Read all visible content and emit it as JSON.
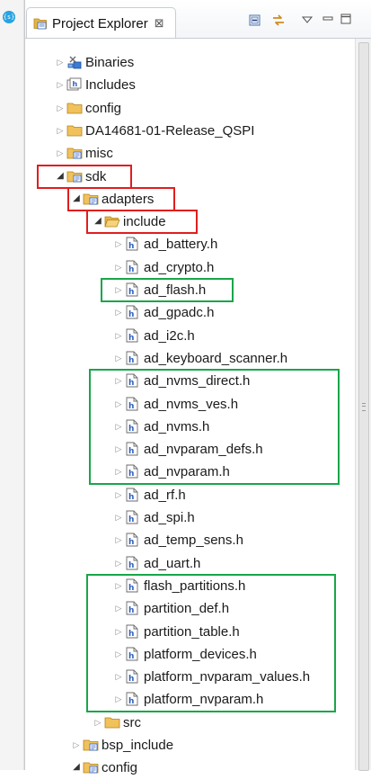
{
  "view": {
    "title": "Project Explorer",
    "close_glyph": "⊠",
    "side_icon": "{s}",
    "toolbar": [
      {
        "name": "collapse-all-icon"
      },
      {
        "name": "link-with-editor-icon"
      },
      {
        "name": "view-menu-icon"
      },
      {
        "name": "minimize-icon"
      },
      {
        "name": "maximize-icon"
      }
    ]
  },
  "colors": {
    "highlight_red": "#e01e1e",
    "highlight_green": "#19a64a",
    "folder": "#e9b443",
    "header_icon": "#2f5fbf"
  },
  "tree": [
    {
      "label": "Binaries",
      "kind": "binaries",
      "depth": 0,
      "state": "collapsed"
    },
    {
      "label": "Includes",
      "kind": "includes",
      "depth": 0,
      "state": "collapsed"
    },
    {
      "label": "config",
      "kind": "folder",
      "depth": 0,
      "state": "collapsed"
    },
    {
      "label": "DA14681-01-Release_QSPI",
      "kind": "folder",
      "depth": 0,
      "state": "collapsed"
    },
    {
      "label": "misc",
      "kind": "srcfolder",
      "depth": 0,
      "state": "collapsed"
    },
    {
      "label": "sdk",
      "kind": "srcfolder",
      "depth": 0,
      "state": "expanded"
    },
    {
      "label": "adapters",
      "kind": "srcfolder",
      "depth": 1,
      "state": "expanded"
    },
    {
      "label": "include",
      "kind": "openfolder",
      "depth": 2,
      "state": "expanded"
    },
    {
      "label": "ad_battery.h",
      "kind": "header",
      "depth": 3,
      "state": "collapsed"
    },
    {
      "label": "ad_crypto.h",
      "kind": "header",
      "depth": 3,
      "state": "collapsed"
    },
    {
      "label": "ad_flash.h",
      "kind": "header",
      "depth": 3,
      "state": "collapsed"
    },
    {
      "label": "ad_gpadc.h",
      "kind": "header",
      "depth": 3,
      "state": "collapsed"
    },
    {
      "label": "ad_i2c.h",
      "kind": "header",
      "depth": 3,
      "state": "collapsed"
    },
    {
      "label": "ad_keyboard_scanner.h",
      "kind": "header",
      "depth": 3,
      "state": "collapsed"
    },
    {
      "label": "ad_nvms_direct.h",
      "kind": "header",
      "depth": 3,
      "state": "collapsed"
    },
    {
      "label": "ad_nvms_ves.h",
      "kind": "header",
      "depth": 3,
      "state": "collapsed"
    },
    {
      "label": "ad_nvms.h",
      "kind": "header",
      "depth": 3,
      "state": "collapsed"
    },
    {
      "label": "ad_nvparam_defs.h",
      "kind": "header",
      "depth": 3,
      "state": "collapsed"
    },
    {
      "label": "ad_nvparam.h",
      "kind": "header",
      "depth": 3,
      "state": "collapsed"
    },
    {
      "label": "ad_rf.h",
      "kind": "header",
      "depth": 3,
      "state": "collapsed"
    },
    {
      "label": "ad_spi.h",
      "kind": "header",
      "depth": 3,
      "state": "collapsed"
    },
    {
      "label": "ad_temp_sens.h",
      "kind": "header",
      "depth": 3,
      "state": "collapsed"
    },
    {
      "label": "ad_uart.h",
      "kind": "header",
      "depth": 3,
      "state": "collapsed"
    },
    {
      "label": "flash_partitions.h",
      "kind": "header",
      "depth": 3,
      "state": "collapsed"
    },
    {
      "label": "partition_def.h",
      "kind": "header",
      "depth": 3,
      "state": "collapsed"
    },
    {
      "label": "partition_table.h",
      "kind": "header",
      "depth": 3,
      "state": "collapsed"
    },
    {
      "label": "platform_devices.h",
      "kind": "header",
      "depth": 3,
      "state": "collapsed"
    },
    {
      "label": "platform_nvparam_values.h",
      "kind": "header",
      "depth": 3,
      "state": "collapsed"
    },
    {
      "label": "platform_nvparam.h",
      "kind": "header",
      "depth": 3,
      "state": "collapsed"
    },
    {
      "label": "src",
      "kind": "folder",
      "depth": 2,
      "state": "collapsed"
    },
    {
      "label": "bsp_include",
      "kind": "srcfolder",
      "depth": 1,
      "state": "collapsed"
    },
    {
      "label": "config",
      "kind": "srcfolder",
      "depth": 1,
      "state": "expanded"
    }
  ],
  "highlights": [
    {
      "color": "red",
      "rows": [
        5,
        5
      ],
      "item": "sdk"
    },
    {
      "color": "red",
      "rows": [
        6,
        6
      ],
      "item": "adapters"
    },
    {
      "color": "red",
      "rows": [
        7,
        7
      ],
      "item": "include"
    },
    {
      "color": "green",
      "rows": [
        10,
        10
      ],
      "item": "ad_flash.h"
    },
    {
      "color": "green",
      "rows": [
        14,
        18
      ],
      "item": "ad_nvms group"
    },
    {
      "color": "green",
      "rows": [
        23,
        28
      ],
      "item": "partition/platform group"
    }
  ]
}
